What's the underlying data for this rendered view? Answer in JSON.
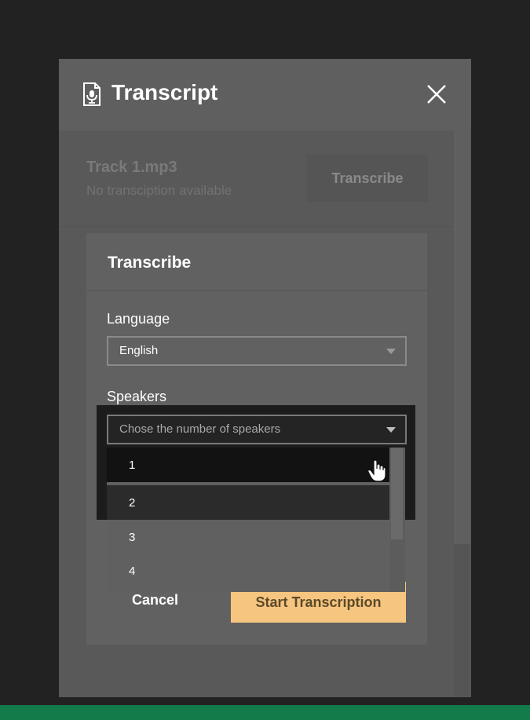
{
  "dialog": {
    "title": "Transcript",
    "icons": {
      "title_icon": "microphone-document-icon",
      "close_icon": "close-icon"
    }
  },
  "track": {
    "name": "Track 1.mp3",
    "status": "No transciption available",
    "transcribe_label": "Transcribe"
  },
  "transcribe_card": {
    "title": "Transcribe",
    "language_label": "Language",
    "language_value": "English",
    "speakers_label": "Speakers",
    "speakers_placeholder": "Chose the number of speakers",
    "speaker_options": [
      "1",
      "2",
      "3",
      "4"
    ],
    "cancel_label": "Cancel",
    "start_label": "Start Transcription"
  },
  "colors": {
    "background": "#222222",
    "panel": "#595959",
    "accent_button": "#f6c57f",
    "bottom_bar": "#137a4a"
  }
}
